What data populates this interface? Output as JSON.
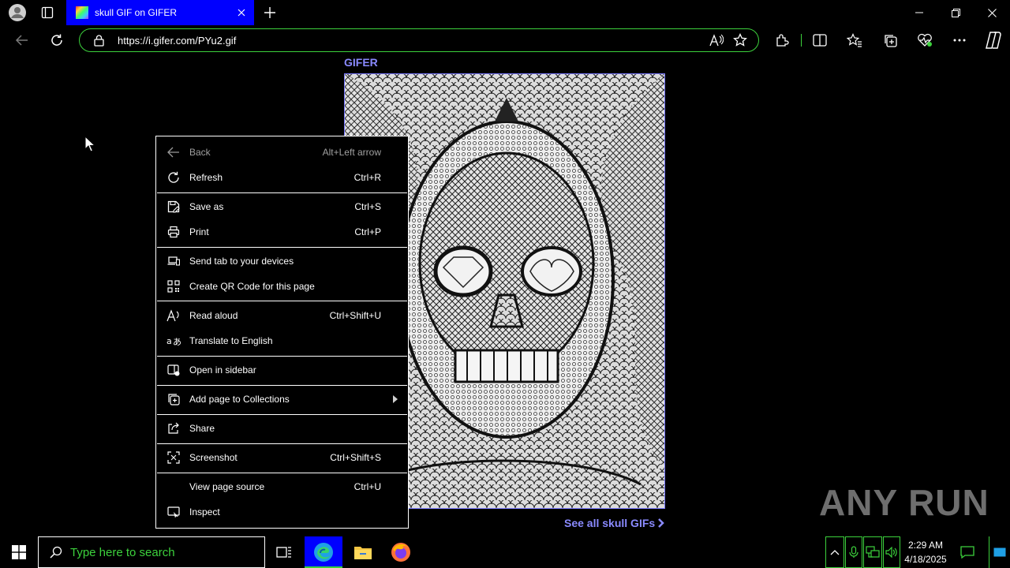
{
  "browser": {
    "tab": {
      "title": "skull GIF on GIFER"
    },
    "address": {
      "url": "https://i.gifer.com/PYu2.gif"
    }
  },
  "page": {
    "logo": "GIFER",
    "see_all": "See all skull GIFs"
  },
  "watermark": "ANY RUN",
  "context_menu": {
    "items": [
      {
        "label": "Back",
        "shortcut": "Alt+Left arrow",
        "icon": "back-arrow-icon",
        "disabled": true
      },
      {
        "label": "Refresh",
        "shortcut": "Ctrl+R",
        "icon": "refresh-icon"
      },
      {
        "label": "Save as",
        "shortcut": "Ctrl+S",
        "icon": "save-as-icon"
      },
      {
        "label": "Print",
        "shortcut": "Ctrl+P",
        "icon": "print-icon"
      },
      {
        "label": "Send tab to your devices",
        "shortcut": "",
        "icon": "send-tab-icon"
      },
      {
        "label": "Create QR Code for this page",
        "shortcut": "",
        "icon": "qr-code-icon"
      },
      {
        "label": "Read aloud",
        "shortcut": "Ctrl+Shift+U",
        "icon": "read-aloud-icon"
      },
      {
        "label": "Translate to English",
        "shortcut": "",
        "icon": "translate-icon"
      },
      {
        "label": "Open in sidebar",
        "shortcut": "",
        "icon": "sidebar-icon"
      },
      {
        "label": "Add page to Collections",
        "shortcut": "",
        "icon": "collections-icon",
        "submenu": true
      },
      {
        "label": "Share",
        "shortcut": "",
        "icon": "share-icon"
      },
      {
        "label": "Screenshot",
        "shortcut": "Ctrl+Shift+S",
        "icon": "screenshot-icon"
      },
      {
        "label": "View page source",
        "shortcut": "Ctrl+U",
        "icon": ""
      },
      {
        "label": "Inspect",
        "shortcut": "",
        "icon": "inspect-icon"
      }
    ]
  },
  "taskbar": {
    "search_placeholder": "Type here to search",
    "time": "2:29 AM",
    "date": "4/18/2025"
  },
  "colors": {
    "accent_blue": "#0000ff",
    "accent_green": "#3cd13c",
    "link_purple": "#8a8aff"
  }
}
